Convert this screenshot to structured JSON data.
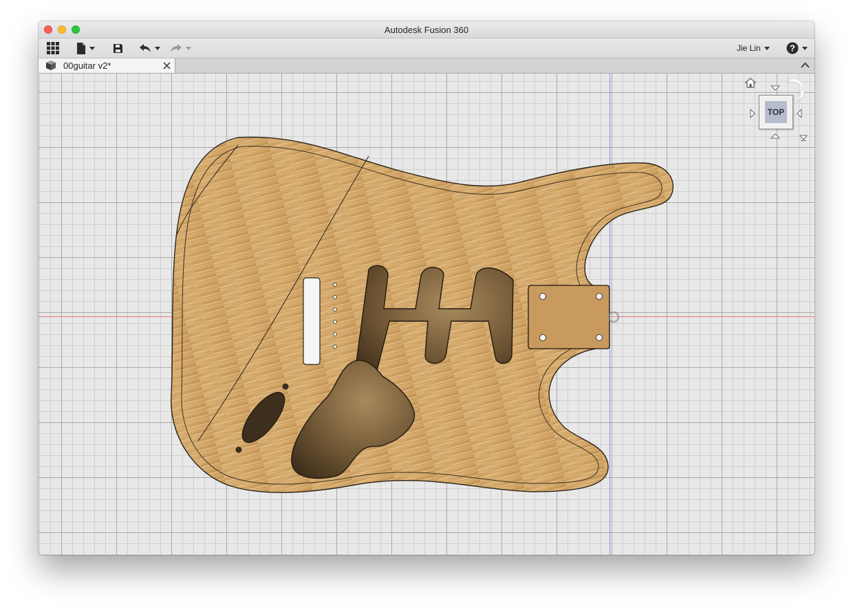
{
  "window": {
    "title": "Autodesk Fusion 360"
  },
  "toolbar": {
    "items": [
      {
        "name": "data-panel",
        "icon": "grid-icon"
      },
      {
        "name": "file-menu",
        "icon": "file-icon",
        "has_dropdown": true
      },
      {
        "name": "save",
        "icon": "save-icon"
      },
      {
        "name": "undo",
        "icon": "undo-icon",
        "has_dropdown": true
      },
      {
        "name": "redo",
        "icon": "redo-icon",
        "has_dropdown": true,
        "enabled": false
      }
    ],
    "user_label": "Jie Lin",
    "help_icon": "help-icon"
  },
  "tabs": [
    {
      "label": "00guitar v2*",
      "icon": "component-icon",
      "close_icon": "close-icon",
      "active": true
    }
  ],
  "viewcube": {
    "face_label": "TOP"
  },
  "colors": {
    "wood": "#d6ad6f",
    "cavity": "#5a4428",
    "x_axis": "#e27a7a",
    "y_axis": "#8a8af5",
    "grid_major": "#a9a9a9",
    "grid_minor": "#cfcfcf"
  }
}
